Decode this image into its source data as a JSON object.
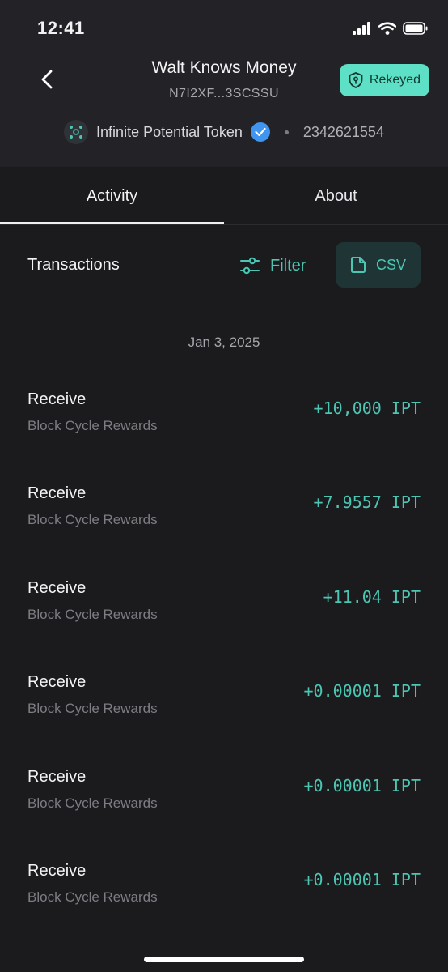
{
  "status_bar": {
    "time": "12:41"
  },
  "header": {
    "title": "Walt Knows Money",
    "address": "N7I2XF...3SCSSU",
    "rekeyed_label": "Rekeyed"
  },
  "asset": {
    "name": "Infinite Potential Token",
    "id": "2342621554",
    "accent_color": "#4cc6b3"
  },
  "tabs": [
    {
      "label": "Activity",
      "active": true
    },
    {
      "label": "About",
      "active": false
    }
  ],
  "transactions_section": {
    "title": "Transactions",
    "filter_label": "Filter",
    "csv_label": "CSV"
  },
  "date_group": "Jan 3, 2025",
  "transactions": [
    {
      "type": "Receive",
      "subtitle": "Block Cycle Rewards",
      "amount": "+10,000 IPT"
    },
    {
      "type": "Receive",
      "subtitle": "Block Cycle Rewards",
      "amount": "+7.9557 IPT"
    },
    {
      "type": "Receive",
      "subtitle": "Block Cycle Rewards",
      "amount": "+11.04 IPT"
    },
    {
      "type": "Receive",
      "subtitle": "Block Cycle Rewards",
      "amount": "+0.00001 IPT"
    },
    {
      "type": "Receive",
      "subtitle": "Block Cycle Rewards",
      "amount": "+0.00001 IPT"
    },
    {
      "type": "Receive",
      "subtitle": "Block Cycle Rewards",
      "amount": "+0.00001 IPT"
    }
  ]
}
